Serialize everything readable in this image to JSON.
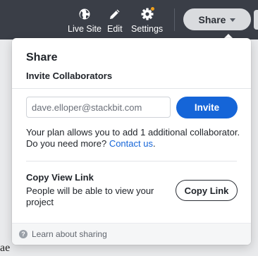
{
  "toolbar": {
    "live_site": "Live Site",
    "edit": "Edit",
    "settings": "Settings",
    "share": "Share"
  },
  "background": {
    "fragment": "ae"
  },
  "share_popover": {
    "title": "Share",
    "invite_heading": "Invite Collaborators",
    "email_placeholder": "dave.elloper@stackbit.com",
    "invite_button": "Invite",
    "plan_text": "Your plan allows you to add 1 additional collaborator. Do you need more?",
    "contact_link": "Contact us",
    "plan_text_end": ".",
    "copy_heading": "Copy View Link",
    "copy_description": "People will be able to view your project",
    "copy_button": "Copy Link",
    "footer_help": "Learn about sharing"
  },
  "colors": {
    "topbar": "#3a3e47",
    "accent": "#1565d8",
    "notification": "#f0a01c"
  },
  "icons": [
    "globe-icon",
    "pencil-icon",
    "gear-icon",
    "caret-down-icon",
    "help-icon"
  ]
}
